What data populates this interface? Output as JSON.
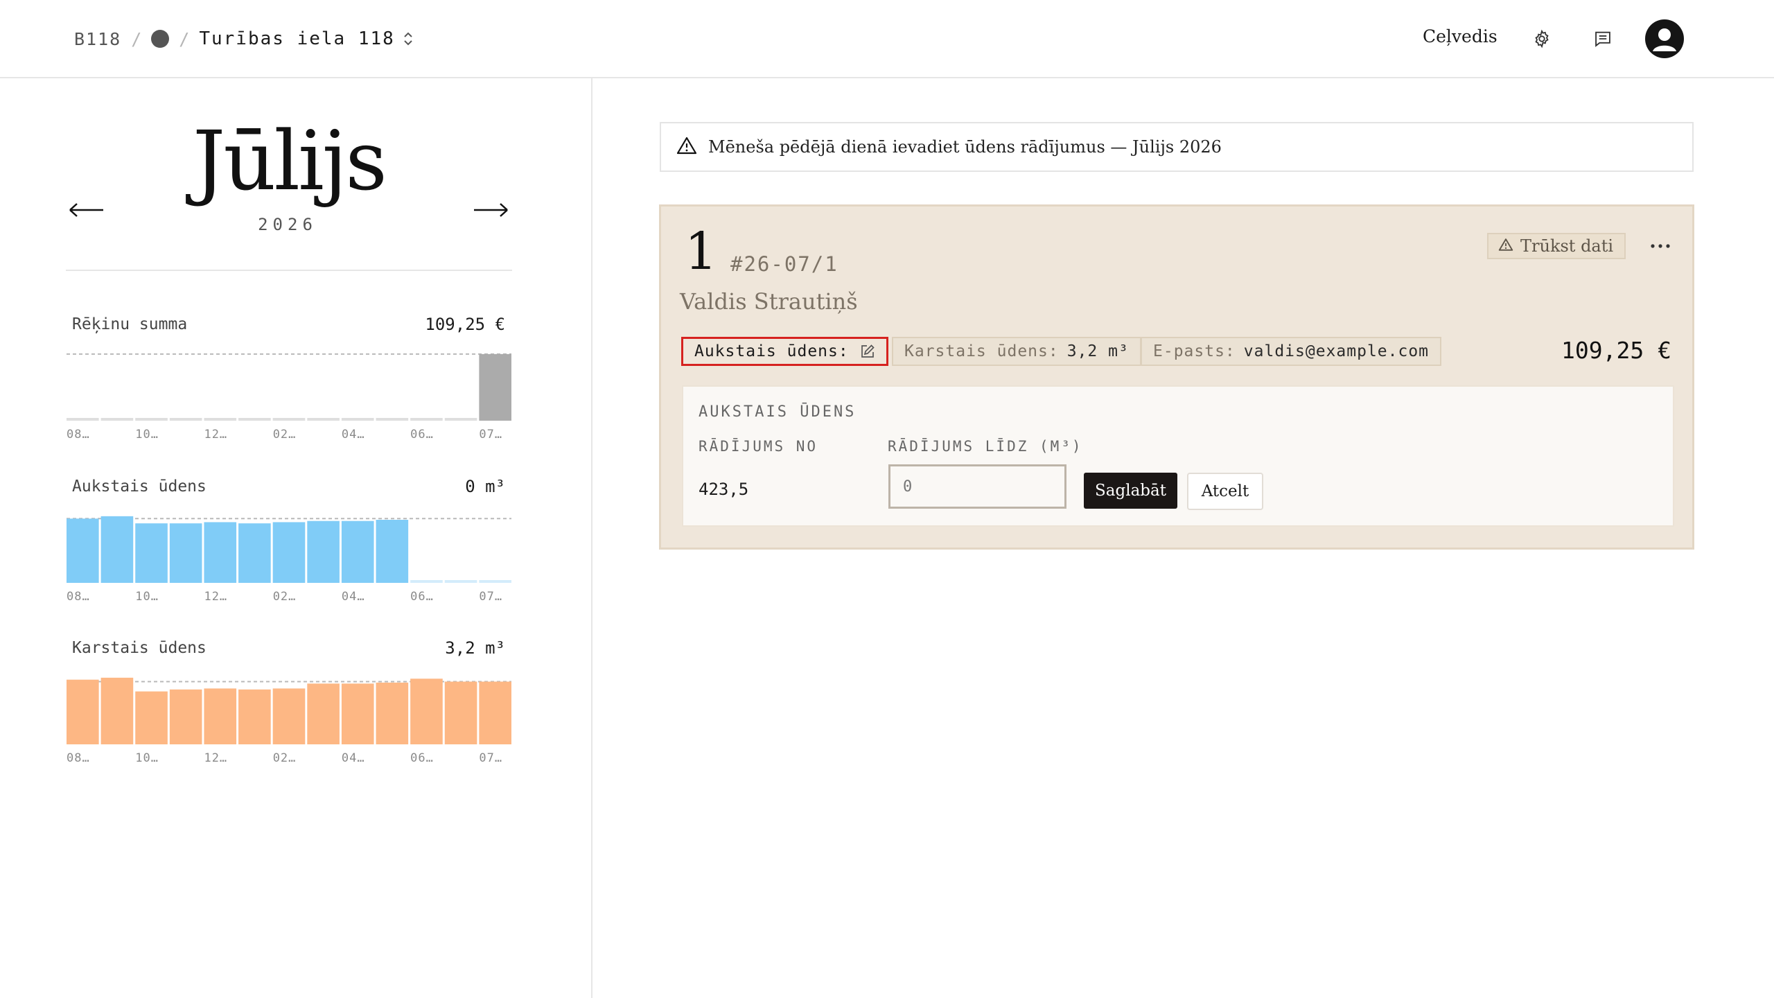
{
  "header": {
    "building_code": "B118",
    "separator": "/",
    "address": "Turības iela 118",
    "guide_label": "Ceļvedis",
    "icons": [
      "chevron-updown-icon",
      "gear-icon",
      "message-icon",
      "avatar-icon"
    ]
  },
  "sidebar": {
    "month": "Jūlijs",
    "year": "2026",
    "prev_icon": "arrow-left-icon",
    "next_icon": "arrow-right-icon",
    "month_ticks": [
      "08…",
      "10…",
      "12…",
      "02…",
      "04…",
      "06…",
      "07…"
    ],
    "metrics": [
      {
        "label": "Rēķinu summa",
        "value": "109,25 €",
        "color": "#ababab",
        "baseline_color": "#dedede",
        "values": [
          0,
          0,
          0,
          0,
          0,
          0,
          0,
          0,
          0,
          0,
          0,
          0,
          109.25
        ],
        "reference": 109.25
      },
      {
        "label": "Aukstais ūdens",
        "value": "0 m³",
        "color": "#80ccf7",
        "baseline_color": "#d4ecfb",
        "values": [
          5.4,
          5.6,
          5.0,
          5.0,
          5.1,
          5.0,
          5.1,
          5.2,
          5.2,
          5.3,
          0,
          0,
          0
        ],
        "reference": 5.4
      },
      {
        "label": "Karstais ūdens",
        "value": "3,2 m³",
        "color": "#fdb784",
        "baseline_color": "#fde0c9",
        "values": [
          3.3,
          3.4,
          2.7,
          2.8,
          2.85,
          2.8,
          2.85,
          3.1,
          3.1,
          3.15,
          3.35,
          3.2,
          3.2
        ],
        "reference": 3.2
      }
    ]
  },
  "notice": {
    "icon": "warning-icon",
    "text": "Mēneša pēdējā dienā ievadiet ūdens rādījumus — Jūlijs 2026"
  },
  "apartment": {
    "number": "1",
    "invoice": "#26-07/1",
    "tenant": "Valdis Strautiņš",
    "status_label": "Trūkst dati",
    "status_icon": "warning-icon",
    "more_icon": "more-horizontal-icon",
    "cold_label": "Aukstais ūdens:",
    "hot_label": "Karstais ūdens:",
    "hot_value": "3,2 m³",
    "email_label": "E-pasts:",
    "email_value": "valdis@example.com",
    "total": "109,25 €",
    "accent_color": "#d6221f"
  },
  "editor": {
    "title": "AUKSTAIS ŪDENS",
    "from_label": "RĀDĪJUMS NO",
    "to_label": "RĀDĪJUMS LĪDZ (M³)",
    "from_value": "423,5",
    "to_placeholder": "0",
    "save_label": "Saglabāt",
    "cancel_label": "Atcelt"
  }
}
